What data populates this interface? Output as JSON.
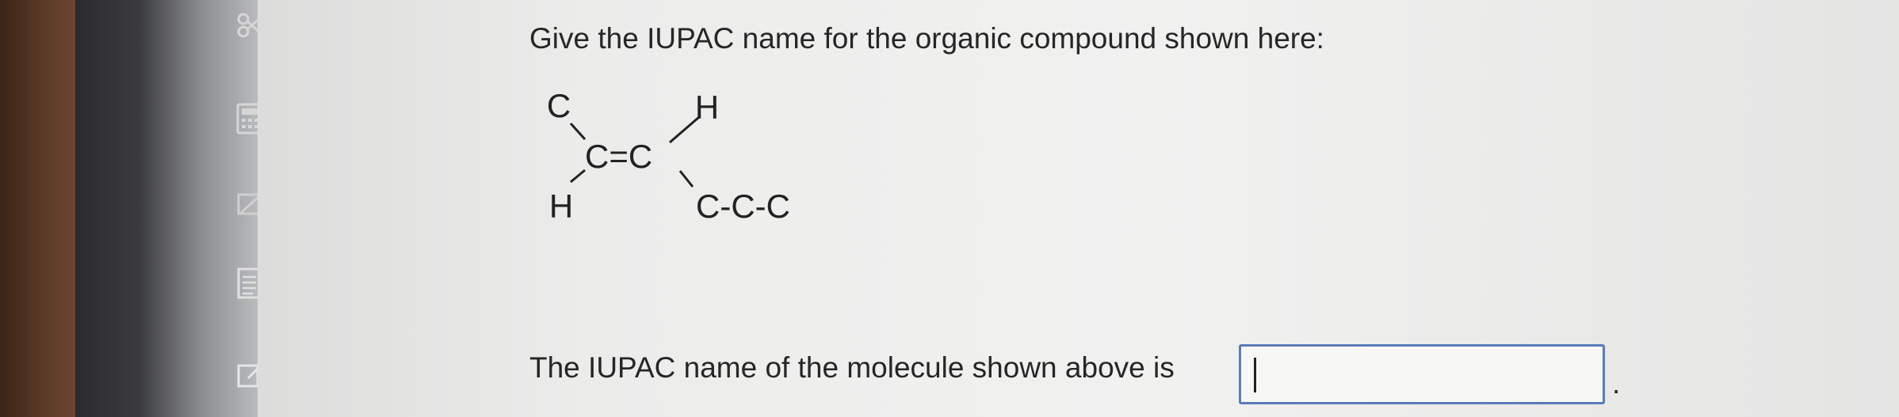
{
  "question": {
    "prompt": "Give the IUPAC name for the organic compound shown here:"
  },
  "molecule": {
    "atoms": {
      "top_left": "C",
      "top_right": "H",
      "double_bond": "C=C",
      "bottom_left": "H",
      "chain": "C-C-C"
    }
  },
  "answer": {
    "label": "The IUPAC name of the molecule shown above is",
    "value": "",
    "trailing_punctuation": "."
  },
  "toolbar": {
    "icons": [
      "scissors-icon",
      "calculator-icon",
      "flag-icon",
      "notes-icon",
      "pencil-icon"
    ]
  },
  "colors": {
    "input_border": "#5b7bb8",
    "text": "#262626"
  }
}
